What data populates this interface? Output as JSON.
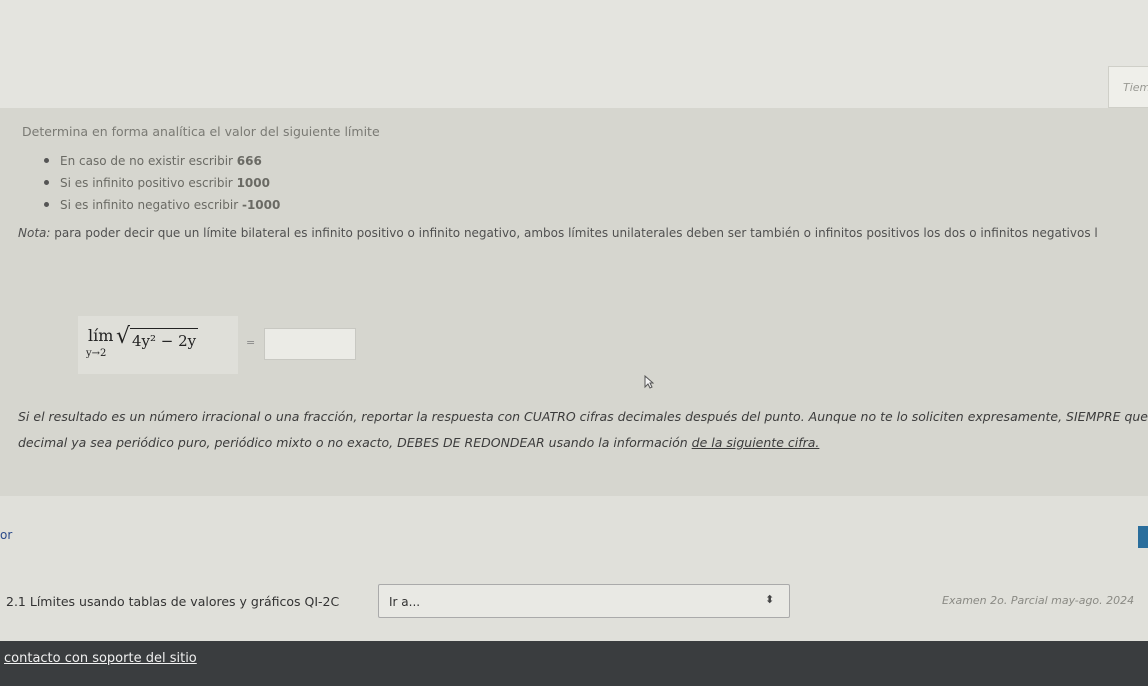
{
  "corner_card": {
    "text": "Tiem"
  },
  "question": {
    "instruction": "Determina en forma analítica el valor del siguiente límite",
    "options": [
      {
        "prefix": "En caso de no existir escribir ",
        "value": "666"
      },
      {
        "prefix": "Si es infinito positivo escribir ",
        "value": "1000"
      },
      {
        "prefix": "Si es infinito negativo escribir ",
        "value": "-1000"
      }
    ],
    "note_label": "Nota:",
    "note_text": " para poder decir que un límite bilateral es infinito positivo o infinito negativo, ambos límites unilaterales deben ser también o infinitos positivos los dos o infinitos negativos l",
    "formula": {
      "lim": "lím",
      "subscript": "y→2",
      "radicand": "4y² − 2y"
    },
    "equals": "=",
    "answer_value": "",
    "rounding_line1": "Si el resultado es un número irracional o una fracción, reportar la respuesta con CUATRO cifras decimales después del punto. Aunque no te lo soliciten expresamente, SIEMPRE que conte",
    "rounding_line2_a": "decimal ya sea periódico puro, periódico mixto o no exacto, DEBES DE REDONDEAR usando la información ",
    "rounding_line2_b": "de la siguiente cifra."
  },
  "navigation": {
    "prev_link_partial": "or",
    "prev_activity": "2.1 Límites usando tablas de valores y gráficos QI-2C",
    "jump_select_value": "Ir a...",
    "jump_select_arrow": "⬍",
    "next_activity": "Examen 2o. Parcial may-ago. 2024"
  },
  "footer": {
    "link": "contacto con soporte del sitio"
  }
}
